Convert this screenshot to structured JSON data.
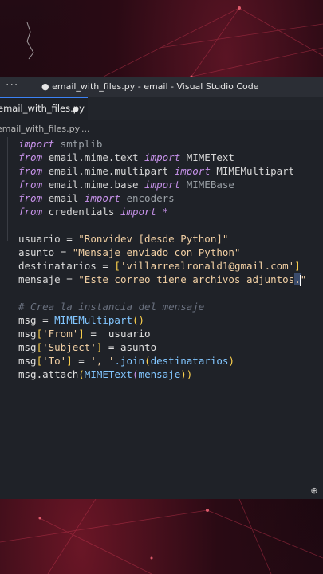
{
  "window": {
    "title": "● email_with_files.py - email - Visual Studio Code",
    "menu_glyph": "···"
  },
  "tab": {
    "label": "email_with_files.py"
  },
  "breadcrumb": {
    "file": "email_with_files.py",
    "chevron": "›",
    "more": "..."
  },
  "code": {
    "l1": {
      "kw": "import",
      "rest": " smtplib"
    },
    "l2": {
      "kw": "from",
      "a": " email.mime.text ",
      "kw2": "import",
      "b": " MIMEText"
    },
    "l3": {
      "kw": "from",
      "a": " email.mime.multipart ",
      "kw2": "import",
      "b": " MIMEMultipart"
    },
    "l4": {
      "kw": "from",
      "a": " email.mime.base ",
      "kw2": "import",
      "b": " MIMEBase"
    },
    "l5": {
      "kw": "from",
      "a": " email ",
      "kw2": "import",
      "b": " encoders"
    },
    "l6": {
      "kw": "from",
      "a": " credentials ",
      "kw2": "import",
      "b": " *"
    },
    "l8": {
      "name": "usuario",
      "eq": " = ",
      "val": "\"Ronvidev [desde Python]\""
    },
    "l9": {
      "name": "asunto",
      "eq": " = ",
      "val": "\"Mensaje enviado con Python\""
    },
    "l10": {
      "name": "destinatarios",
      "eq": " = ",
      "open": "[",
      "val": "'villarrealronald1@gmail.com'",
      "close": "]"
    },
    "l11": {
      "name": "mensaje",
      "eq": " = ",
      "val_a": "\"Este correo tiene archivos adjuntos",
      "val_b": ".",
      "val_c": "\""
    },
    "l13": {
      "comment": "# Crea la instancia del mensaje"
    },
    "l14": {
      "a": "msg = ",
      "fn": "MIMEMultipart",
      "p": "()"
    },
    "l15": {
      "a": "msg",
      "o": "[",
      "s": "'From'",
      "c": "]",
      "b": " =  usuario"
    },
    "l16": {
      "a": "msg",
      "o": "[",
      "s": "'Subject'",
      "c": "]",
      "b": " = asunto"
    },
    "l17": {
      "a": "msg",
      "o": "[",
      "s": "'To'",
      "c": "]",
      "b": " = ",
      "s2": "', '",
      "j": ".join",
      "p1": "(",
      "arg": "destinatarios",
      "p2": ")"
    },
    "l18": {
      "a": "msg.attach",
      "p1": "(",
      "fn": "MIMEText",
      "p2": "(",
      "arg": "mensaje",
      "p3": "))"
    }
  },
  "status": {
    "zoom_glyph": "⊕"
  }
}
